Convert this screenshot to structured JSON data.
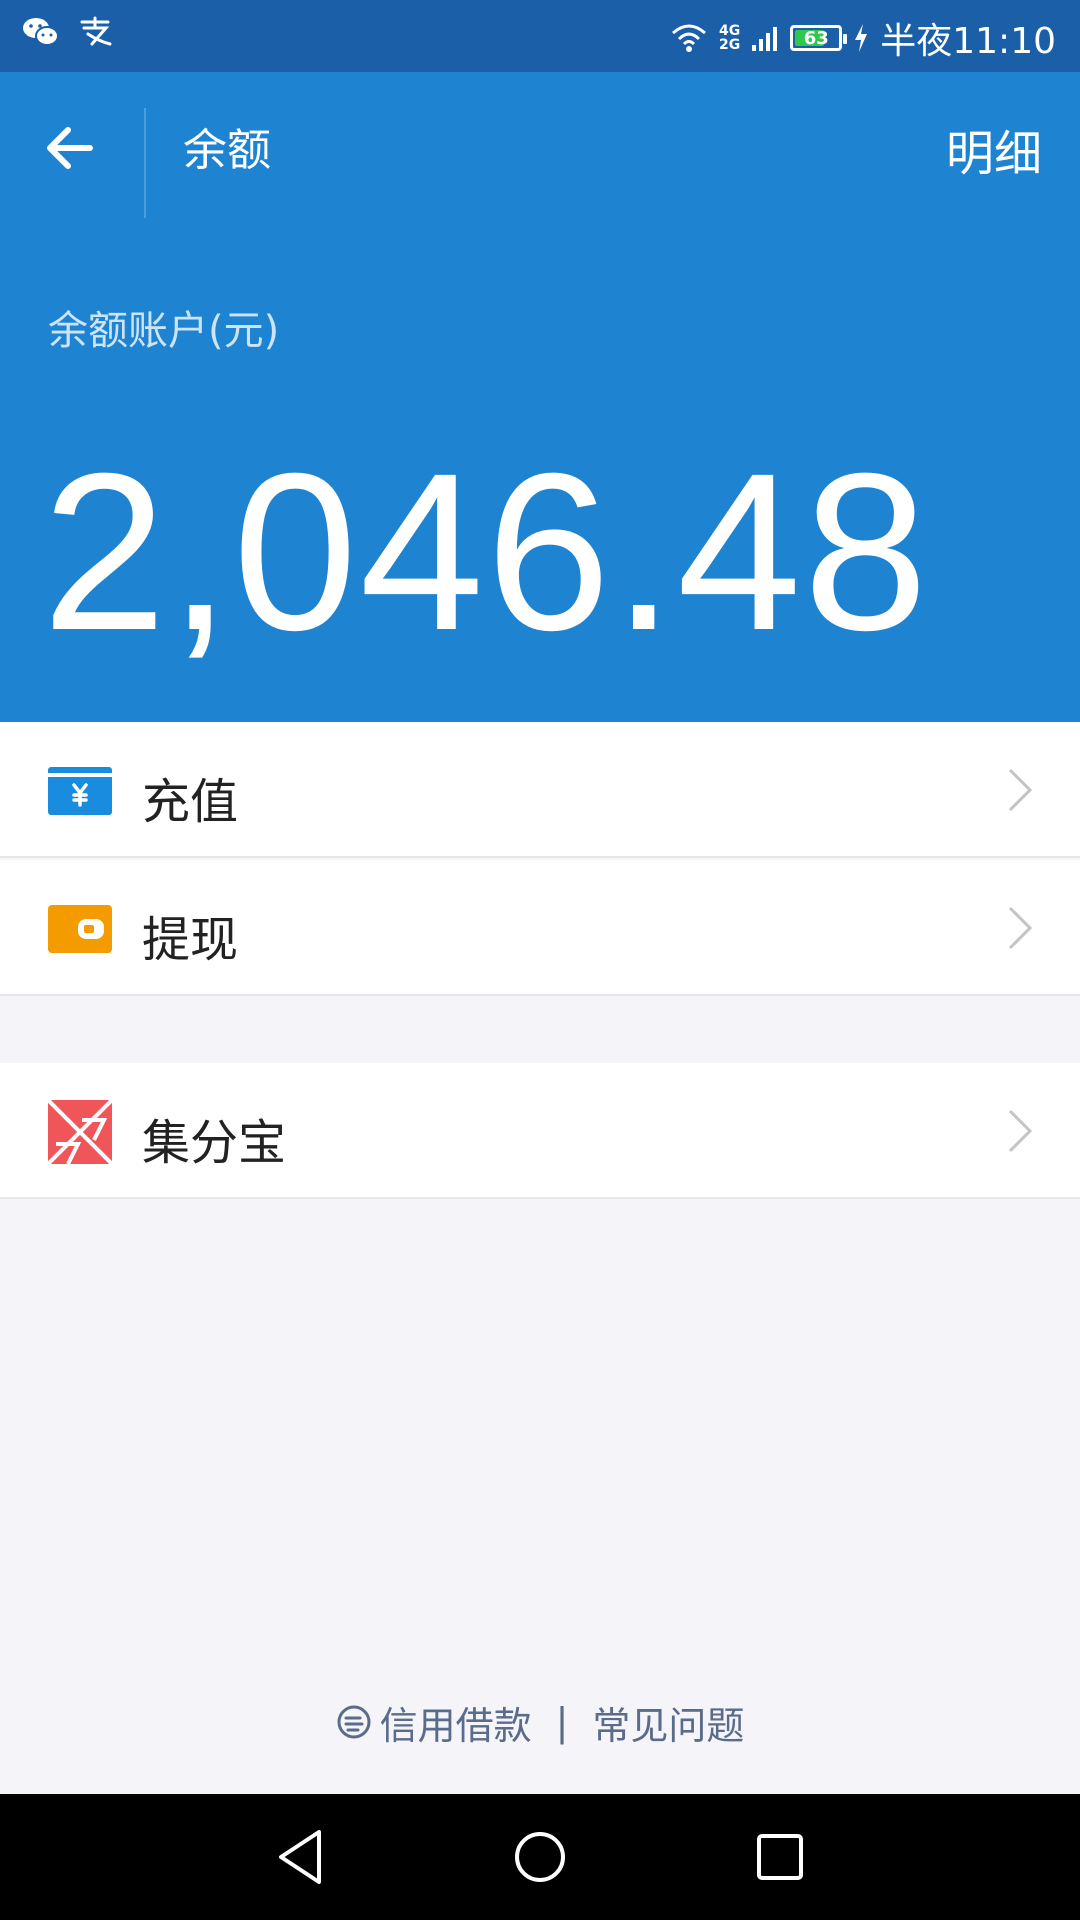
{
  "status_bar": {
    "time": "半夜11:10",
    "battery_level": "63",
    "network_top": "4G",
    "network_bottom": "2G",
    "icons": [
      "wechat-icon",
      "alipay-icon",
      "wifi-icon",
      "signal-icon",
      "battery-icon",
      "charging-icon"
    ]
  },
  "header": {
    "title": "余额",
    "detail_link": "明细",
    "balance_label": "余额账户(元)",
    "balance_amount": "2,046.48",
    "background": "#1e84d2"
  },
  "menu": [
    {
      "label": "充值",
      "icon": "recharge-icon",
      "icon_color": "#1a8ce0"
    },
    {
      "label": "提现",
      "icon": "withdraw-icon",
      "icon_color": "#f49b00"
    },
    {
      "label": "集分宝",
      "icon": "jifenbao-icon",
      "icon_color": "#f0555a"
    }
  ],
  "footer": {
    "credit_loan": "信用借款",
    "separator": "|",
    "faq": "常见问题"
  },
  "nav": [
    "back-nav-icon",
    "home-nav-icon",
    "recents-nav-icon"
  ]
}
